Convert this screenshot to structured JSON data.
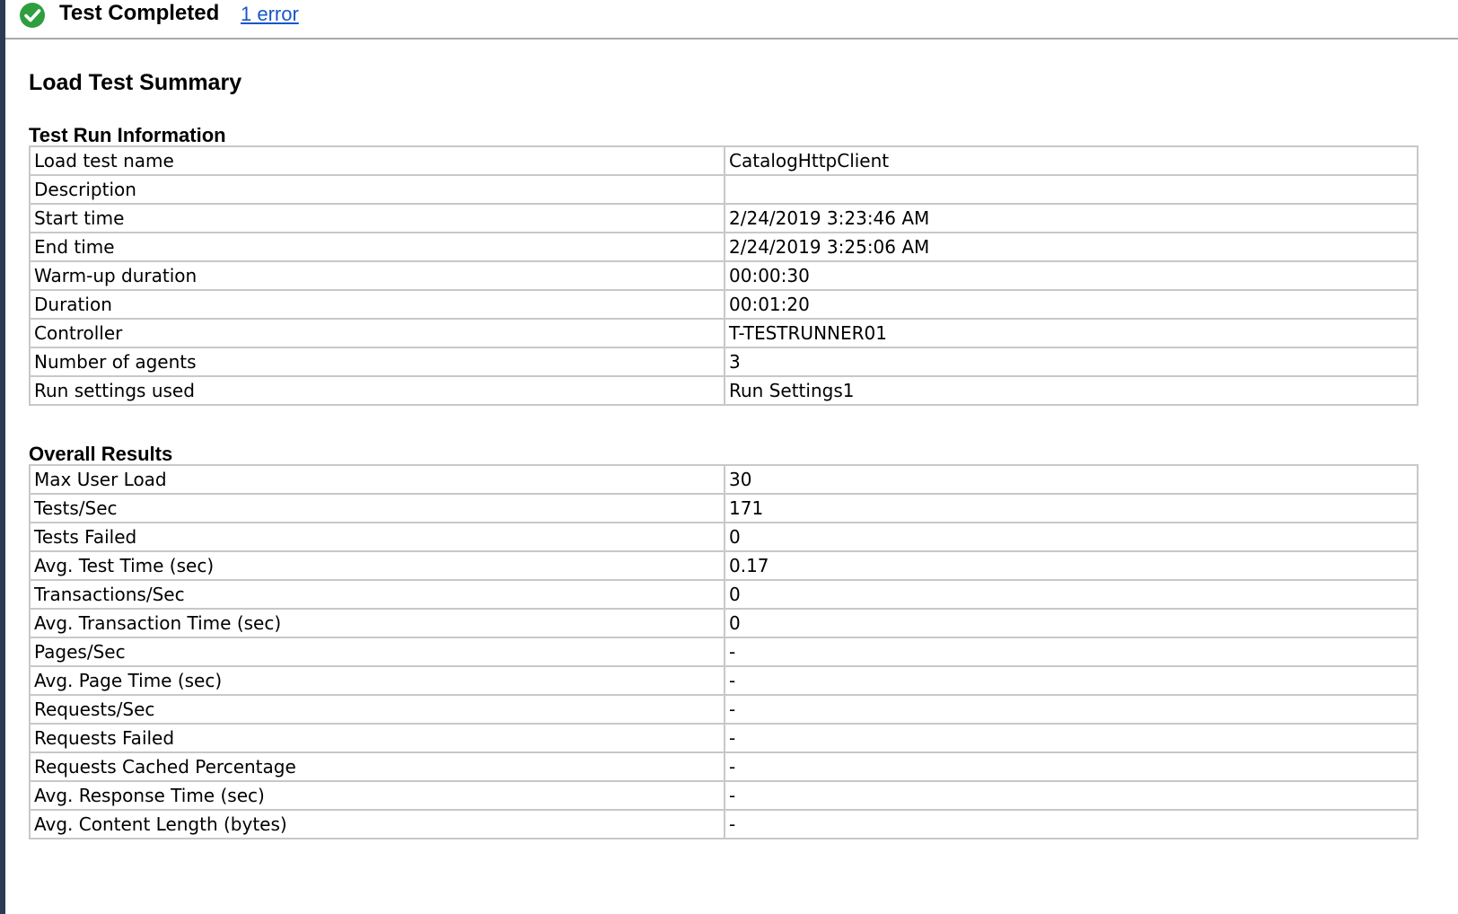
{
  "status": {
    "title": "Test Completed",
    "error_link": "1 error",
    "icon": "check-circle-icon",
    "icon_color": "#2e9e3e"
  },
  "page_title": "Load Test Summary",
  "test_run_information": {
    "title": "Test Run Information",
    "rows": [
      {
        "label": "Load test name",
        "value": "CatalogHttpClient"
      },
      {
        "label": "Description",
        "value": ""
      },
      {
        "label": "Start time",
        "value": "2/24/2019 3:23:46 AM"
      },
      {
        "label": "End time",
        "value": "2/24/2019 3:25:06 AM"
      },
      {
        "label": "Warm-up duration",
        "value": "00:00:30"
      },
      {
        "label": "Duration",
        "value": "00:01:20"
      },
      {
        "label": "Controller",
        "value": "T-TESTRUNNER01"
      },
      {
        "label": "Number of agents",
        "value": "3"
      },
      {
        "label": "Run settings used",
        "value": "Run Settings1"
      }
    ]
  },
  "overall_results": {
    "title": "Overall Results",
    "rows": [
      {
        "label": "Max User Load",
        "value": "30"
      },
      {
        "label": "Tests/Sec",
        "value": "171"
      },
      {
        "label": "Tests Failed",
        "value": "0"
      },
      {
        "label": "Avg. Test Time (sec)",
        "value": "0.17"
      },
      {
        "label": "Transactions/Sec",
        "value": "0"
      },
      {
        "label": "Avg. Transaction Time (sec)",
        "value": "0"
      },
      {
        "label": "Pages/Sec",
        "value": "-"
      },
      {
        "label": "Avg. Page Time (sec)",
        "value": "-"
      },
      {
        "label": "Requests/Sec",
        "value": "-"
      },
      {
        "label": "Requests Failed",
        "value": "-"
      },
      {
        "label": "Requests Cached Percentage",
        "value": "-"
      },
      {
        "label": "Avg. Response Time (sec)",
        "value": "-"
      },
      {
        "label": "Avg. Content Length (bytes)",
        "value": "-"
      }
    ]
  }
}
